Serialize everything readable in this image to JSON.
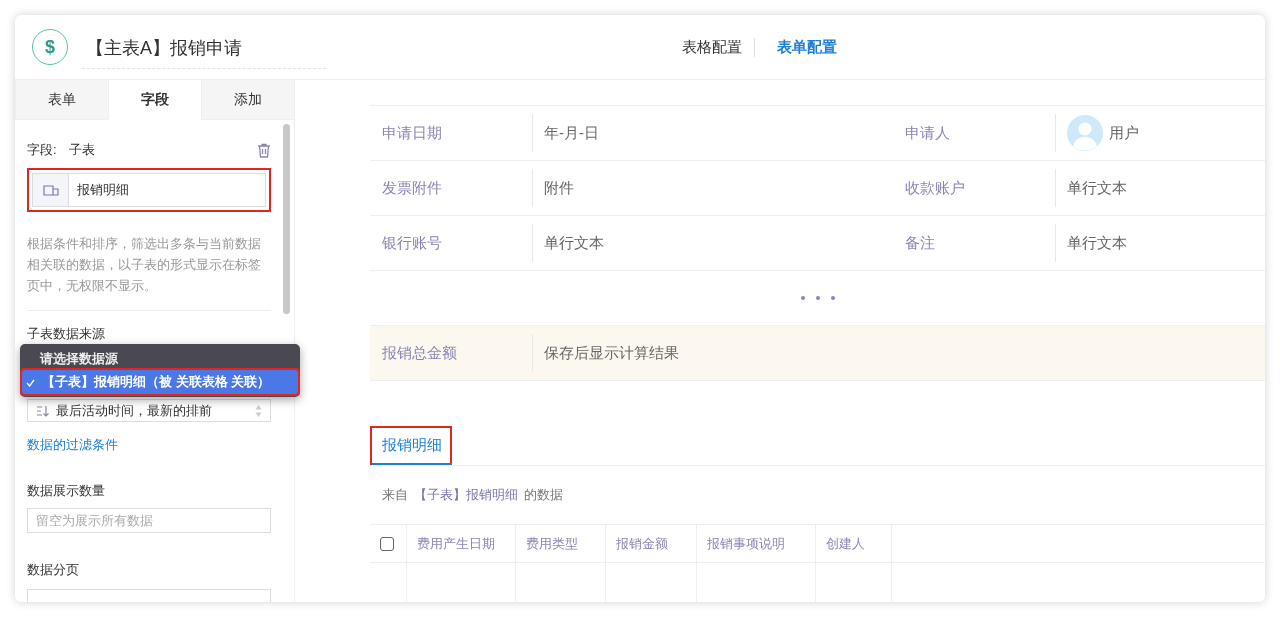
{
  "header": {
    "logo": "$",
    "title": "【主表A】报销申请",
    "nav": [
      {
        "label": "表格配置",
        "selected": false
      },
      {
        "label": "表单配置",
        "selected": true
      }
    ]
  },
  "sidebar": {
    "tabs": [
      {
        "label": "表单",
        "selected": false
      },
      {
        "label": "字段",
        "selected": true
      },
      {
        "label": "添加",
        "selected": false
      }
    ],
    "field_label": "字段:",
    "field_type": "子表",
    "name_input": {
      "value": "报销明细",
      "highlighted": true
    },
    "description": "根据条件和排序，筛选出多条与当前数据相关联的数据，以子表的形式显示在标签页中，无权限不显示。",
    "source_label": "子表数据来源",
    "source_menu": {
      "header": "请选择数据源",
      "options": [
        {
          "label": "【子表】报销明细（被 关联表格 关联）",
          "selected": true,
          "highlighted": true
        }
      ]
    },
    "sort_select": {
      "value": "最后活动时间，最新的排前"
    },
    "filter_link": "数据的过滤条件",
    "count_label": "数据展示数量",
    "count_input": {
      "placeholder": "留空为展示所有数据"
    },
    "paging_label": "数据分页"
  },
  "form": {
    "rows": [
      {
        "cells": [
          {
            "label": "申请日期",
            "value": "年-月-日",
            "kind": "text"
          },
          {
            "label": "申请人",
            "value": "用户",
            "kind": "user"
          }
        ]
      },
      {
        "cells": [
          {
            "label": "发票附件",
            "value": "附件",
            "kind": "text"
          },
          {
            "label": "收款账户",
            "value": "单行文本",
            "kind": "text"
          }
        ]
      },
      {
        "cells": [
          {
            "label": "银行账号",
            "value": "单行文本",
            "kind": "text"
          },
          {
            "label": "备注",
            "value": "单行文本",
            "kind": "text"
          }
        ]
      }
    ],
    "total": {
      "label": "报销总金额",
      "value": "保存后显示计算结果"
    }
  },
  "subtable": {
    "tabs": [
      {
        "label": "报销明细",
        "selected": true,
        "highlighted": true
      }
    ],
    "source_note": {
      "prefix": "来自",
      "link": "【子表】报销明细",
      "suffix": "的数据"
    },
    "select_all": {
      "checked": false
    },
    "columns": [
      "费用产生日期",
      "费用类型",
      "报销金额",
      "报销事项说明",
      "创建人"
    ]
  }
}
